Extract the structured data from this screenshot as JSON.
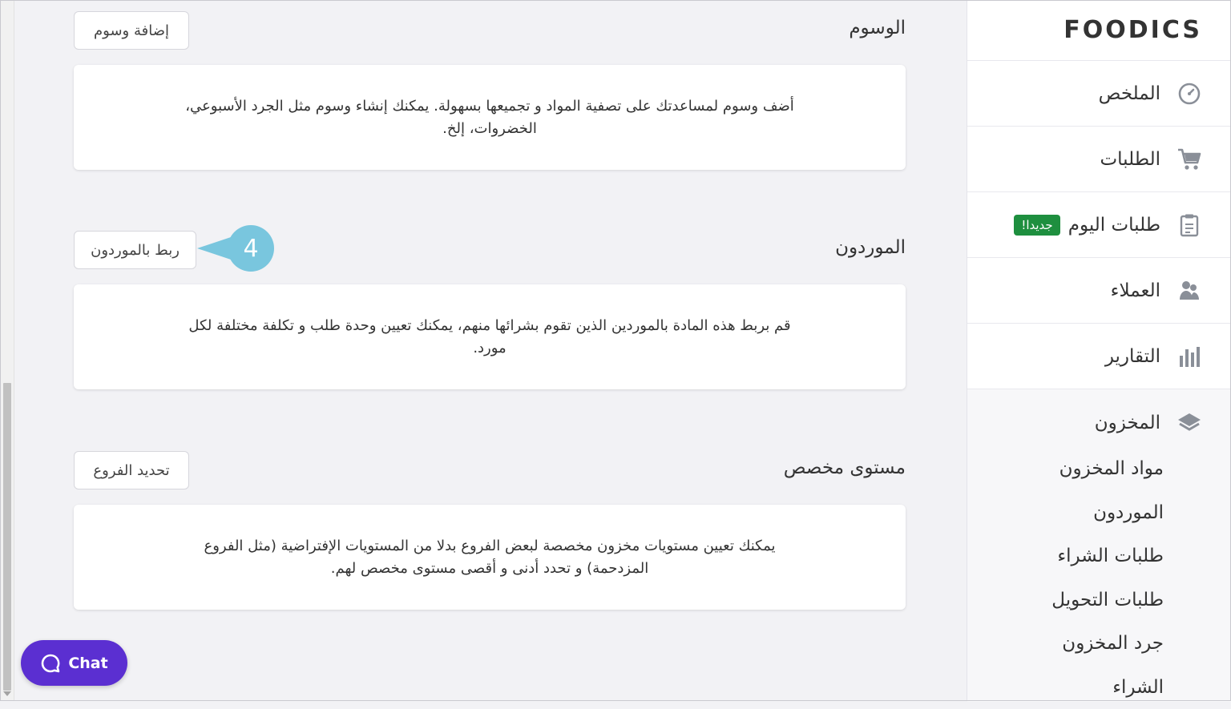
{
  "brand": {
    "logo_text": "FOODICS"
  },
  "sidebar": {
    "items": [
      {
        "label": "الملخص",
        "icon": "dashboard-gauge-icon"
      },
      {
        "label": "الطلبات",
        "icon": "cart-icon"
      },
      {
        "label": "طلبات اليوم",
        "icon": "clipboard-icon",
        "badge": "جديدا!"
      },
      {
        "label": "العملاء",
        "icon": "customers-icon"
      },
      {
        "label": "التقارير",
        "icon": "bar-chart-icon"
      }
    ],
    "inventory": {
      "label": "المخزون",
      "icon": "layers-icon",
      "subitems": [
        "مواد المخزون",
        "الموردون",
        "طلبات الشراء",
        "طلبات التحويل",
        "جرد المخزون",
        "الشراء"
      ]
    },
    "badge_color": "#1e8f3f"
  },
  "sections": {
    "tags": {
      "title": "الوسوم",
      "button": "إضافة وسوم",
      "description": "أضف وسوم لمساعدتك على تصفية المواد و تجميعها بسهولة. يمكنك إنشاء وسوم مثل الجرد الأسبوعي، الخضروات، إلخ."
    },
    "suppliers": {
      "title": "الموردون",
      "button": "ربط بالموردون",
      "description": "قم بربط هذه المادة بالموردين الذين تقوم بشرائها منهم، يمكنك تعيين وحدة طلب و تكلفة مختلفة لكل مورد."
    },
    "custom_level": {
      "title": "مستوى مخصص",
      "button": "تحديد الفروع",
      "description": "يمكنك تعيين مستويات مخزون مخصصة لبعض الفروع بدلا من المستويات الإفتراضية (مثل الفروع المزدحمة) و تحدد أدنى و أقصى مستوى مخصص لهم."
    }
  },
  "callout": {
    "number": "4",
    "color": "#79c6de"
  },
  "chat": {
    "label": "Chat",
    "color": "#5b2fd1"
  }
}
